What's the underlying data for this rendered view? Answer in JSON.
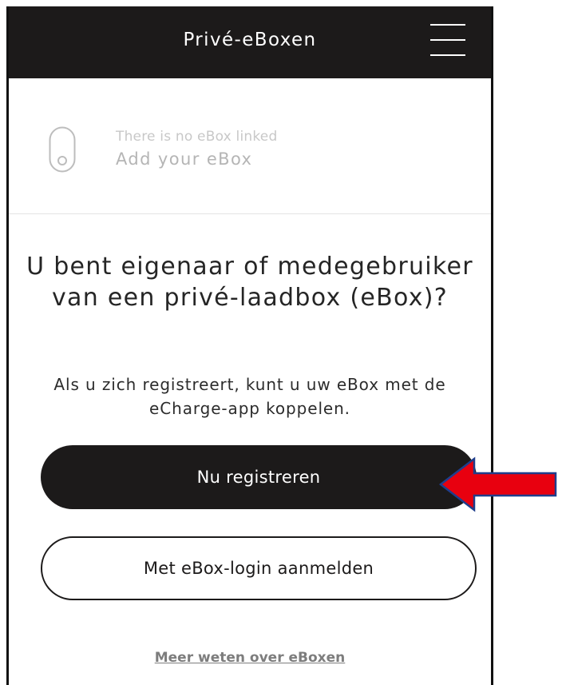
{
  "header": {
    "title": "Privé-eBoxen"
  },
  "ebox": {
    "subtitle": "There is no eBox linked",
    "title": "Add your eBox"
  },
  "main": {
    "question": "U bent eigenaar of medegebruiker van een privé-laadbox (eBox)?",
    "explanation": "Als u zich registreert, kunt u uw eBox met de eCharge-app koppelen.",
    "register_label": "Nu registreren",
    "login_label": "Met eBox-login aanmelden",
    "more_link": "Meer weten over eBoxen"
  },
  "colors": {
    "header_bg": "#1c1a1a",
    "annotation_arrow": "#e8000f",
    "annotation_arrow_outline": "#1f3e8c"
  },
  "icons": {
    "menu": "hamburger-menu-icon",
    "ebox": "ebox-device-icon",
    "annotation": "red-arrow-pointer"
  }
}
